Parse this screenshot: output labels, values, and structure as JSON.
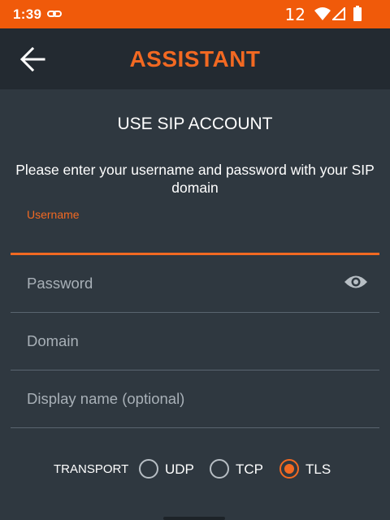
{
  "status_bar": {
    "time": "1:39",
    "network_label": "12",
    "icons": [
      "link-icon",
      "wifi-icon",
      "signal-icon",
      "battery-icon"
    ]
  },
  "toolbar": {
    "title": "ASSISTANT",
    "back_icon": "back-arrow-icon"
  },
  "content": {
    "heading": "USE SIP ACCOUNT",
    "instructions": "Please enter your username and password with your SIP domain"
  },
  "form": {
    "username": {
      "label": "Username",
      "value": ""
    },
    "password": {
      "placeholder": "Password",
      "value": "",
      "toggle_icon": "eye-icon"
    },
    "domain": {
      "placeholder": "Domain",
      "value": ""
    },
    "display_name": {
      "placeholder": "Display name (optional)",
      "value": ""
    }
  },
  "transport": {
    "label": "TRANSPORT",
    "options": [
      {
        "label": "UDP",
        "checked": false
      },
      {
        "label": "TCP",
        "checked": false
      },
      {
        "label": "TLS",
        "checked": true
      }
    ]
  },
  "colors": {
    "accent": "#f26922",
    "status_bar": "#f05a0a",
    "toolbar": "#232a31",
    "background": "#2f3840"
  }
}
